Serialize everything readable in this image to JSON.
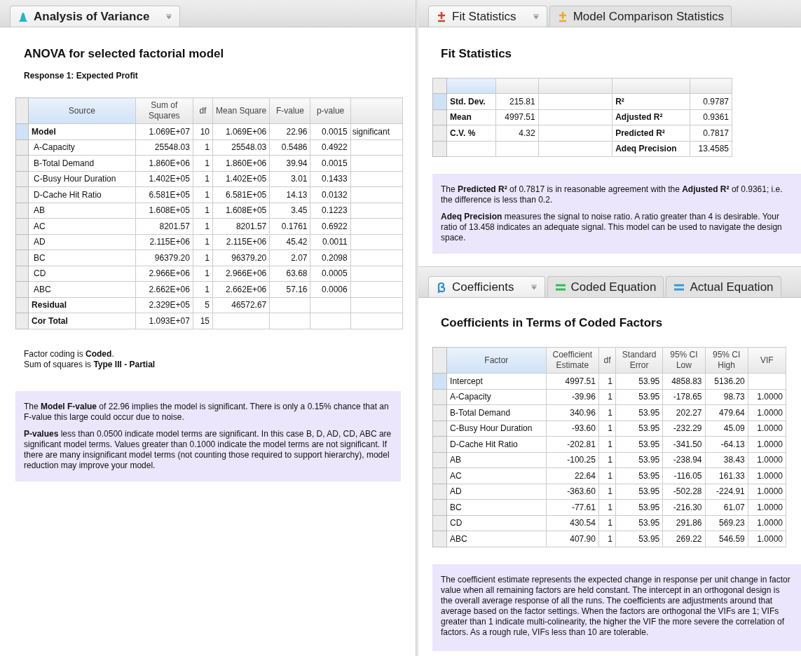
{
  "left": {
    "tabs": [
      {
        "label": "Analysis of Variance",
        "kind": "bell",
        "color": "#20b8cc",
        "selected": true,
        "dropdown": true
      }
    ],
    "title": "ANOVA for selected factorial model",
    "subtitle": "Response 1: Expected Profit",
    "table": {
      "columns": [
        "Source",
        "Sum of Squares",
        "df",
        "Mean Square",
        "F-value",
        "p-value",
        ""
      ],
      "rows": [
        {
          "kind": "summary",
          "selected": true,
          "cells": [
            "Model",
            "1.069E+07",
            "10",
            "1.069E+06",
            "22.96",
            "0.0015",
            "significant"
          ]
        },
        {
          "kind": "term",
          "selected": false,
          "cells": [
            "A-Capacity",
            "25548.03",
            "1",
            "25548.03",
            "0.5486",
            "0.4922",
            ""
          ]
        },
        {
          "kind": "term",
          "selected": false,
          "cells": [
            "B-Total Demand",
            "1.860E+06",
            "1",
            "1.860E+06",
            "39.94",
            "0.0015",
            ""
          ]
        },
        {
          "kind": "term",
          "selected": false,
          "cells": [
            "C-Busy Hour Duration",
            "1.402E+05",
            "1",
            "1.402E+05",
            "3.01",
            "0.1433",
            ""
          ]
        },
        {
          "kind": "term",
          "selected": false,
          "cells": [
            "D-Cache Hit Ratio",
            "6.581E+05",
            "1",
            "6.581E+05",
            "14.13",
            "0.0132",
            ""
          ]
        },
        {
          "kind": "term",
          "selected": false,
          "cells": [
            "AB",
            "1.608E+05",
            "1",
            "1.608E+05",
            "3.45",
            "0.1223",
            ""
          ]
        },
        {
          "kind": "term",
          "selected": false,
          "cells": [
            "AC",
            "8201.57",
            "1",
            "8201.57",
            "0.1761",
            "0.6922",
            ""
          ]
        },
        {
          "kind": "term",
          "selected": false,
          "cells": [
            "AD",
            "2.115E+06",
            "1",
            "2.115E+06",
            "45.42",
            "0.0011",
            ""
          ]
        },
        {
          "kind": "term",
          "selected": false,
          "cells": [
            "BC",
            "96379.20",
            "1",
            "96379.20",
            "2.07",
            "0.2098",
            ""
          ]
        },
        {
          "kind": "term",
          "selected": false,
          "cells": [
            "CD",
            "2.966E+06",
            "1",
            "2.966E+06",
            "63.68",
            "0.0005",
            ""
          ]
        },
        {
          "kind": "term",
          "selected": false,
          "cells": [
            "ABC",
            "2.662E+06",
            "1",
            "2.662E+06",
            "57.16",
            "0.0006",
            ""
          ]
        },
        {
          "kind": "summary",
          "selected": false,
          "cells": [
            "Residual",
            "2.329E+05",
            "5",
            "46572.67",
            "",
            "",
            ""
          ]
        },
        {
          "kind": "summary",
          "selected": false,
          "cells": [
            "Cor Total",
            "1.093E+07",
            "15",
            "",
            "",
            "",
            ""
          ]
        }
      ]
    },
    "notes": [
      "Factor coding is **Coded**.",
      "Sum of squares is **Type III - Partial**"
    ],
    "info": [
      "The **Model F-value** of 22.96 implies the model is significant. There is only a 0.15% chance that an F-value this large could occur due to noise.",
      "**P-values** less than 0.0500 indicate model terms are significant. In this case B, D, AD, CD, ABC are significant model terms. Values greater than 0.1000 indicate the model terms are not significant. If there are many insignificant model terms (not counting those required to support hierarchy), model reduction may improve your model."
    ]
  },
  "fit": {
    "tabs": [
      {
        "label": "Fit Statistics",
        "kind": "plusminus",
        "color": "#d9402a",
        "selected": true,
        "dropdown": true
      },
      {
        "label": "Model Comparison Statistics",
        "kind": "plusminus",
        "color": "#f0a81c",
        "selected": false,
        "dropdown": false
      }
    ],
    "title": "Fit Statistics",
    "rows": [
      {
        "selected": true,
        "cells": [
          "Std. Dev.",
          "215.81",
          "",
          "R²",
          "0.9787"
        ]
      },
      {
        "selected": false,
        "cells": [
          "Mean",
          "4997.51",
          "",
          "Adjusted R²",
          "0.9361"
        ]
      },
      {
        "selected": false,
        "cells": [
          "C.V. %",
          "4.32",
          "",
          "Predicted R²",
          "0.7817"
        ]
      },
      {
        "selected": false,
        "cells": [
          "",
          "",
          "",
          "Adeq Precision",
          "13.4585"
        ]
      }
    ],
    "info": [
      "The **Predicted R²** of 0.7817 is in reasonable agreement with the **Adjusted R²** of 0.9361; i.e. the difference is less than 0.2.",
      "**Adeq Precision** measures the signal to noise ratio. A ratio greater than 4 is desirable. Your ratio of 13.458 indicates an adequate signal. This model can be used to navigate the design space."
    ]
  },
  "coef": {
    "tabs": [
      {
        "label": "Coefficients",
        "kind": "beta",
        "color": "#2f8fd6",
        "selected": true,
        "dropdown": true
      },
      {
        "label": "Coded Equation",
        "kind": "equals",
        "color": "#3cb55a",
        "selected": false,
        "dropdown": false
      },
      {
        "label": "Actual Equation",
        "kind": "equals",
        "color": "#3a98d8",
        "selected": false,
        "dropdown": false
      }
    ],
    "title": "Coefficients in Terms of Coded Factors",
    "table": {
      "columns": [
        "Factor",
        "Coefficient Estimate",
        "df",
        "Standard Error",
        "95% CI Low",
        "95% CI High",
        "VIF"
      ],
      "rows": [
        {
          "selected": true,
          "cells": [
            "Intercept",
            "4997.51",
            "1",
            "53.95",
            "4858.83",
            "5136.20",
            ""
          ]
        },
        {
          "selected": false,
          "cells": [
            "A-Capacity",
            "-39.96",
            "1",
            "53.95",
            "-178.65",
            "98.73",
            "1.0000"
          ]
        },
        {
          "selected": false,
          "cells": [
            "B-Total Demand",
            "340.96",
            "1",
            "53.95",
            "202.27",
            "479.64",
            "1.0000"
          ]
        },
        {
          "selected": false,
          "cells": [
            "C-Busy Hour Duration",
            "-93.60",
            "1",
            "53.95",
            "-232.29",
            "45.09",
            "1.0000"
          ]
        },
        {
          "selected": false,
          "cells": [
            "D-Cache Hit Ratio",
            "-202.81",
            "1",
            "53.95",
            "-341.50",
            "-64.13",
            "1.0000"
          ]
        },
        {
          "selected": false,
          "cells": [
            "AB",
            "-100.25",
            "1",
            "53.95",
            "-238.94",
            "38.43",
            "1.0000"
          ]
        },
        {
          "selected": false,
          "cells": [
            "AC",
            "22.64",
            "1",
            "53.95",
            "-116.05",
            "161.33",
            "1.0000"
          ]
        },
        {
          "selected": false,
          "cells": [
            "AD",
            "-363.60",
            "1",
            "53.95",
            "-502.28",
            "-224.91",
            "1.0000"
          ]
        },
        {
          "selected": false,
          "cells": [
            "BC",
            "-77.61",
            "1",
            "53.95",
            "-216.30",
            "61.07",
            "1.0000"
          ]
        },
        {
          "selected": false,
          "cells": [
            "CD",
            "430.54",
            "1",
            "53.95",
            "291.86",
            "569.23",
            "1.0000"
          ]
        },
        {
          "selected": false,
          "cells": [
            "ABC",
            "407.90",
            "1",
            "53.95",
            "269.22",
            "546.59",
            "1.0000"
          ]
        }
      ]
    },
    "info": [
      "The coefficient estimate represents the expected change in response per unit change in factor value when all remaining factors are held constant. The intercept in an orthogonal design is the overall average response of all the runs. The coefficients are adjustments around that average based on the factor settings. When the factors are orthogonal the VIFs are 1; VIFs greater than 1 indicate multi-colinearity, the higher the VIF the more severe the correlation of factors. As a rough rule, VIFs less than 10 are tolerable."
    ]
  }
}
